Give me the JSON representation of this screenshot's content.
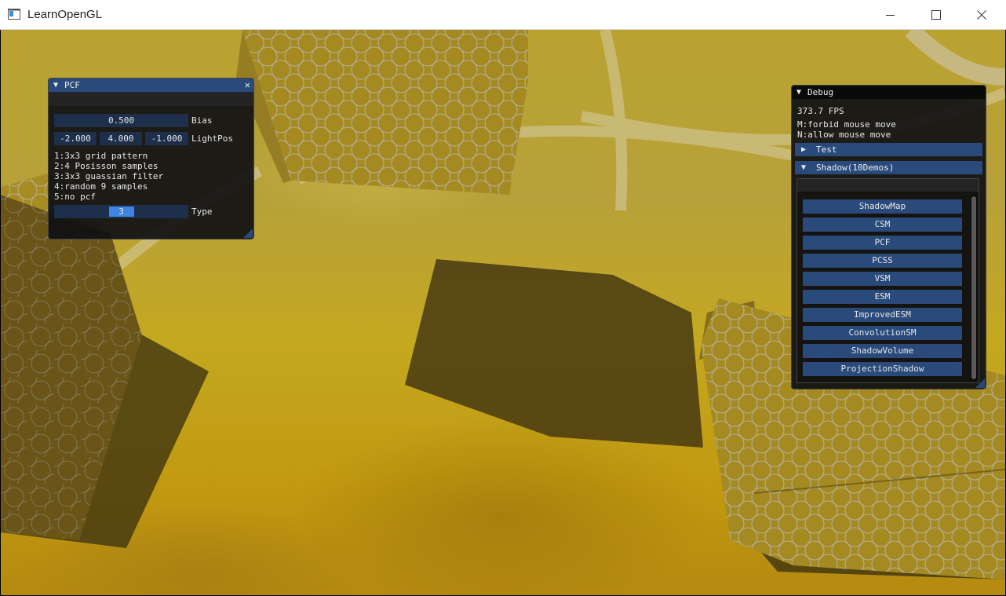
{
  "window": {
    "title": "LearnOpenGL",
    "controls": {
      "minimize_icon": "minimize-icon",
      "maximize_icon": "maximize-icon",
      "close_icon": "close-icon"
    }
  },
  "pcf_panel": {
    "title": "PCF",
    "collapse_glyph": "▼",
    "close_glyph": "✕",
    "bias": {
      "value": "0.500",
      "label": "Bias"
    },
    "lightpos": {
      "x": "-2.000",
      "y": "4.000",
      "z": "-1.000",
      "label": "LightPos"
    },
    "help_lines": [
      "1:3x3 grid pattern",
      "2:4 Posisson samples",
      "3:3x3 guassian filter",
      "4:random 9 samples",
      "5:no pcf"
    ],
    "type": {
      "value": "3",
      "label": "Type",
      "fraction": 0.5
    }
  },
  "debug_panel": {
    "title": "Debug",
    "collapse_glyph": "▼",
    "fps": "373.7 FPS",
    "hint_forbid": "M:forbid mouse move",
    "hint_allow": "N:allow mouse move",
    "test_section": {
      "label": "Test",
      "glyph": "▶"
    },
    "shadow_section": {
      "label": "Shadow(10Demos)",
      "glyph": "▼"
    },
    "demo_buttons": [
      "ShadowMap",
      "CSM",
      "PCF",
      "PCSS",
      "VSM",
      "ESM",
      "ImprovedESM",
      "ConvolutionSM",
      "ShadowVolume",
      "ProjectionShadow"
    ]
  },
  "colors": {
    "header_blue": "#294a7a",
    "frame_blue": "#1d2f4a",
    "slider_grab": "#3d85e0",
    "scene_yellow": "#c4a820"
  }
}
